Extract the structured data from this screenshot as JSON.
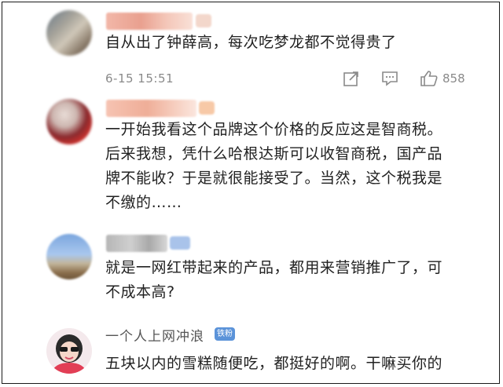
{
  "comments": [
    {
      "username_visible": false,
      "text": "自从出了钟薛高，每次吃梦龙都不觉得贵了",
      "timestamp": "6-15 15:51",
      "like_count": "858"
    },
    {
      "username_visible": false,
      "text": "一开始我看这个品牌这个价格的反应这是智商税。\n后来我想，凭什么哈根达斯可以收智商税，国产品\n牌不能收？于是就很能接受了。当然，这个税我是\n不缴的……"
    },
    {
      "username_visible": false,
      "text": "就是一网红带起来的产品，都用来营销推广了，可\n不成本高?"
    },
    {
      "username": "一个人上网冲浪",
      "badge": "铁粉",
      "text": "五块以内的雪糕随便吃，都挺好的啊。干嘛买你的"
    }
  ],
  "actions": {
    "share_icon": "share-icon",
    "comment_icon": "comment-icon",
    "like_icon": "thumbs-up-icon"
  },
  "colors": {
    "text": "#222222",
    "meta": "#8a8a8a",
    "badge": "#7ea7e0",
    "fan_badge": "#5b93d9"
  }
}
